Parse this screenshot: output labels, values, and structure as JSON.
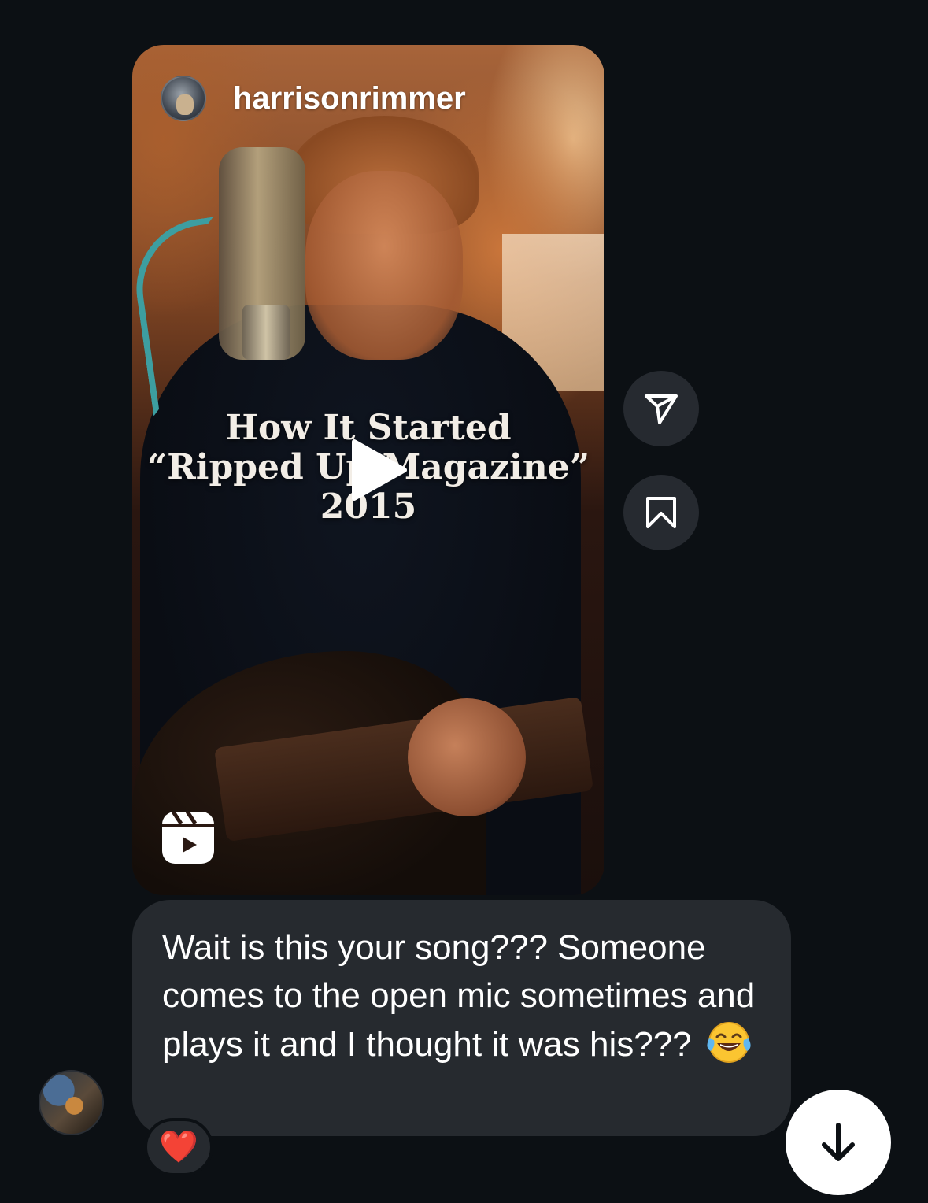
{
  "reel": {
    "username": "harrisonrimmer",
    "caption_lines": [
      "How It Started",
      "“Ripped Up Magazine”",
      "2015"
    ],
    "avatar_icon": "profile-photo",
    "play_icon": "play-icon",
    "reels_icon": "reels-icon"
  },
  "actions": {
    "share_icon": "send-icon",
    "save_icon": "bookmark-icon"
  },
  "message": {
    "text": "Wait is this your song??? Someone comes to the open mic sometimes and plays it and I thought it was his??? ",
    "emoji": "😂",
    "reaction": "❤️"
  },
  "colors": {
    "background": "#0c1014",
    "bubble": "#262a2f",
    "action_button": "#262a30",
    "heart": "#ff3040"
  },
  "scroll_down_icon": "arrow-down-icon"
}
